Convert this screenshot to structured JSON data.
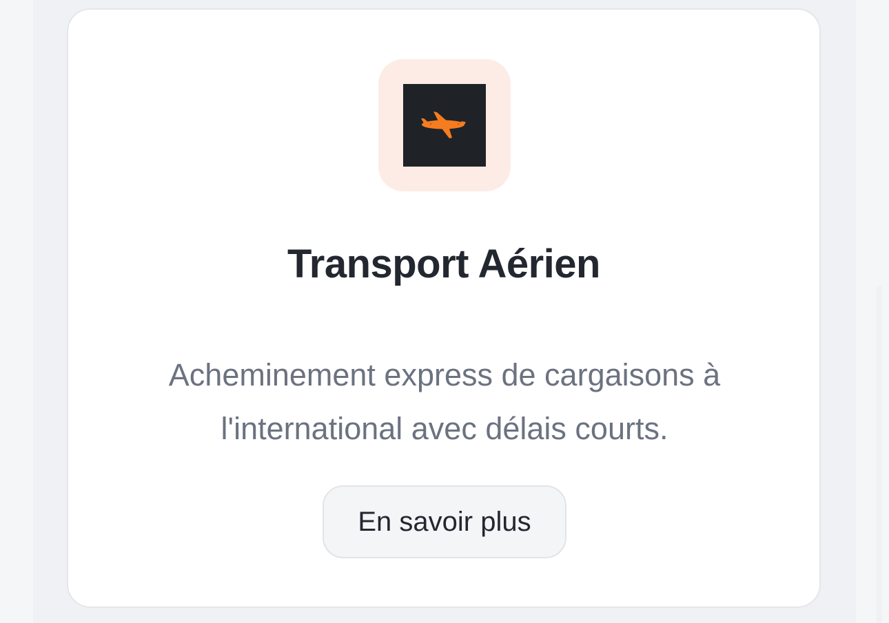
{
  "service_card": {
    "icon": "airplane-icon",
    "icon_color": "#f57c1f",
    "icon_background": "#1f2327",
    "icon_tile_color": "#fdece6",
    "title": "Transport Aérien",
    "description": "Acheminement express de cargaisons à l'international avec délais courts.",
    "cta_label": "En savoir plus"
  }
}
